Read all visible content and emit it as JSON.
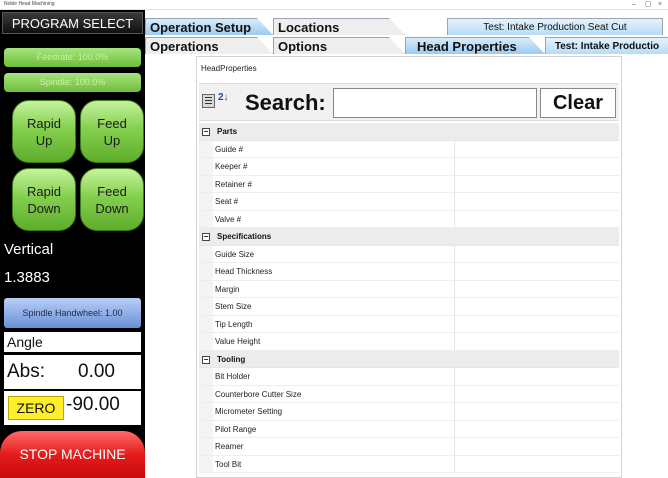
{
  "window": {
    "title": "Noble Head Machining",
    "minimize_glyph": "–",
    "restore_glyph": "▢",
    "close_glyph": "×"
  },
  "left_panel": {
    "program_select": "PROGRAM SELECT",
    "feedrate": "Feedrate: 100.0%",
    "spindle": "Spindle: 100.0%",
    "rapid_up": "Rapid\nUp",
    "feed_up": "Feed\nUp",
    "rapid_down": "Rapid\nDown",
    "feed_down": "Feed\nDown",
    "axis_label": "Vertical",
    "axis_value": "1.3883",
    "spindle_handwheel": "Spindle Handwheel: 1.00",
    "angle_label": "Angle",
    "abs_label": "Abs:",
    "abs_value": "0.00",
    "zero_button": "ZERO",
    "zero_value": "-90.00",
    "stop_machine": "STOP MACHINE"
  },
  "tabs": {
    "row1": [
      "Operation Setup",
      "Locations",
      "Test: Intake Production Seat Cut"
    ],
    "row2": [
      "Operations",
      "Options",
      "Head Properties",
      "Test: Intake Productio"
    ],
    "active": "Head Properties"
  },
  "content": {
    "title": "HeadProperties",
    "search_label": "Search:",
    "search_value": "",
    "clear_label": "Clear",
    "sort_glyph": "2↓"
  },
  "property_grid": {
    "expander_glyph": "−",
    "categories": [
      {
        "name": "Parts",
        "items": [
          "Guide #",
          "Keeper #",
          "Retainer #",
          "Seat #",
          "Valve #"
        ]
      },
      {
        "name": "Specifications",
        "items": [
          "Guide Size",
          "Head Thickness",
          "Margin",
          "Stem Size",
          "Tip Length",
          "Value Height"
        ]
      },
      {
        "name": "Tooling",
        "items": [
          "Bit Holder",
          "Counterbore Cutter Size",
          "Micrometer Setting",
          "Pilot Range",
          "Reamer",
          "Tool Bit"
        ]
      }
    ]
  },
  "colors": {
    "green_button": "#84d04e",
    "stop_red": "#e51c1c",
    "zero_yellow": "#ffee2a",
    "tab_blue": "#9ccbf0",
    "handwheel_blue": "#6b90d8"
  }
}
